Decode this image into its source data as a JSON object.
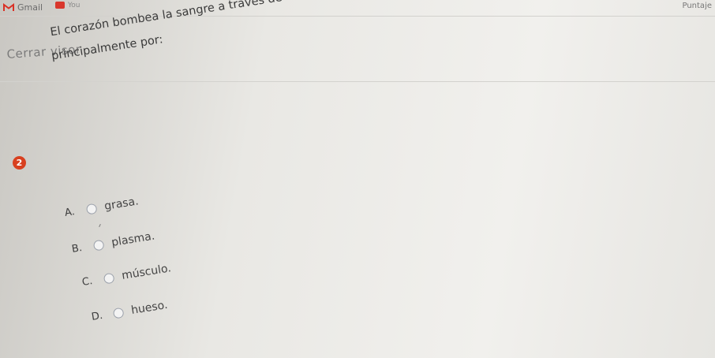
{
  "browser": {
    "gmail_label": "Gmail",
    "youtube_label": "You",
    "score_label": "Puntaje"
  },
  "viewer": {
    "close_label": "Cerrar visor"
  },
  "question": {
    "number": "2",
    "line1": "El corazón bombea la sangre a través de los vasos sanguíneos a todas las partes del cuerpo. Este está conformado",
    "line2": "principalmente por:",
    "options": [
      {
        "letter": "A.",
        "text": "grasa."
      },
      {
        "letter": "B.",
        "text": "plasma."
      },
      {
        "letter": "C.",
        "text": "músculo."
      },
      {
        "letter": "D.",
        "text": "hueso."
      }
    ]
  }
}
